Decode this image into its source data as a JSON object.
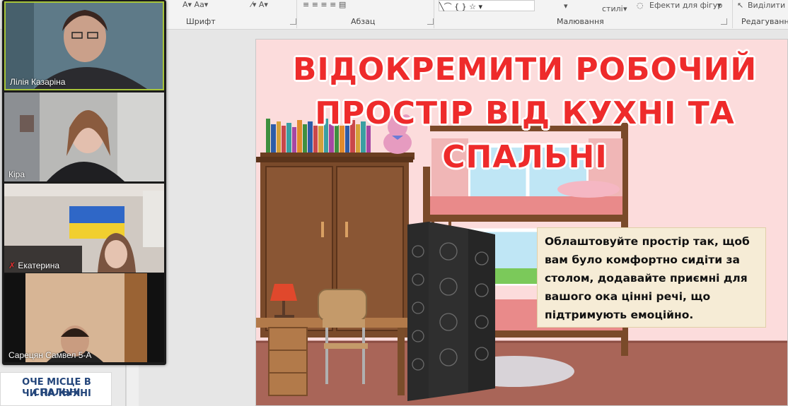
{
  "ribbon": {
    "groups": [
      {
        "label": "Шрифт"
      },
      {
        "label": "Абзац"
      },
      {
        "label": "Малювання"
      },
      {
        "label": "Редагування"
      }
    ],
    "styles_label": "стилі",
    "shape_effects_label": "Ефекти для фігур",
    "select_label": "Виділити"
  },
  "participants": [
    {
      "name": "Лілія Казаріна",
      "active": true
    },
    {
      "name": "Кіра",
      "muted": false
    },
    {
      "name": "Екатерина",
      "muted": true
    },
    {
      "name": "Сарецян Самвел 5-А",
      "muted": false
    }
  ],
  "thumbnail": {
    "line1": "ОЧЕ МІСЦЕ В СПАЛЬНІ",
    "line2": "ЧИ НА КУХНІ"
  },
  "slide": {
    "title_lines": [
      "ВІДОКРЕМИТИ РОБОЧИЙ",
      "ПРОСТІР ВІД КУХНІ ТА",
      "СПАЛЬНІ"
    ],
    "body": "Облаштовуйте простір так, щоб вам було комфортно сидіти за столом, додавайте приємні для вашого ока цінні речі, що підтримують емоційно."
  },
  "colors": {
    "title": "#ee2b2b",
    "wall": "#fcdcdc",
    "floor": "#a96558",
    "wood": "#7a4a2a"
  }
}
